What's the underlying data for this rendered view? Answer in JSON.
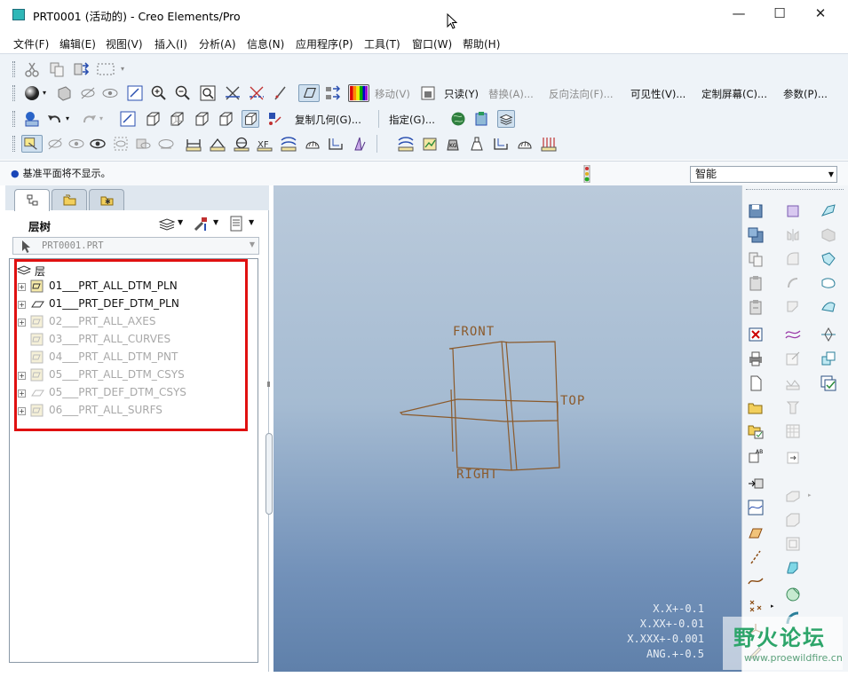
{
  "window": {
    "title": "PRT0001 (活动的) - Creo Elements/Pro",
    "minimize": "—",
    "maximize": "☐",
    "close": "✕"
  },
  "menu": [
    "文件(F)",
    "编辑(E)",
    "视图(V)",
    "插入(I)",
    "分析(A)",
    "信息(N)",
    "应用程序(P)",
    "工具(T)",
    "窗口(W)",
    "帮助(H)"
  ],
  "toolbar": {
    "move": "移动(V)",
    "readonly": "只读(Y)",
    "replace": "替换(A)...",
    "reverse_normal": "反向法向(F)...",
    "visibility": "可见性(V)...",
    "custom_screen": "定制屏幕(C)...",
    "params": "参数(P)...",
    "copy_geom": "复制几何(G)...",
    "assign": "指定(G)..."
  },
  "status": {
    "message": "基准平面将不显示。",
    "filter": "智能"
  },
  "panel": {
    "title": "层树",
    "model": "PRT0001.PRT",
    "root": "层",
    "layers": [
      {
        "name": "01___PRT_ALL_DTM_PLN",
        "dim": false,
        "expandable": true
      },
      {
        "name": "01___PRT_DEF_DTM_PLN",
        "dim": false,
        "expandable": true
      },
      {
        "name": "02___PRT_ALL_AXES",
        "dim": true,
        "expandable": true
      },
      {
        "name": "03___PRT_ALL_CURVES",
        "dim": true,
        "expandable": false
      },
      {
        "name": "04___PRT_ALL_DTM_PNT",
        "dim": true,
        "expandable": false
      },
      {
        "name": "05___PRT_ALL_DTM_CSYS",
        "dim": true,
        "expandable": true
      },
      {
        "name": "05___PRT_DEF_DTM_CSYS",
        "dim": true,
        "expandable": true
      },
      {
        "name": "06___PRT_ALL_SURFS",
        "dim": true,
        "expandable": true
      }
    ]
  },
  "viewport": {
    "labels": {
      "front": "FRONT",
      "top": "TOP",
      "right": "RIGHT"
    },
    "accuracy": [
      "X.X+-0.1",
      "X.XX+-0.01",
      "X.XXX+-0.001",
      "ANG.+-0.5"
    ]
  },
  "watermark": {
    "main": "野火论坛",
    "sub": "www.proewildfire.cn"
  },
  "colors": {
    "highlight": "#e01010",
    "datum": "#8b5a2b",
    "accent": "#1a46b8"
  }
}
